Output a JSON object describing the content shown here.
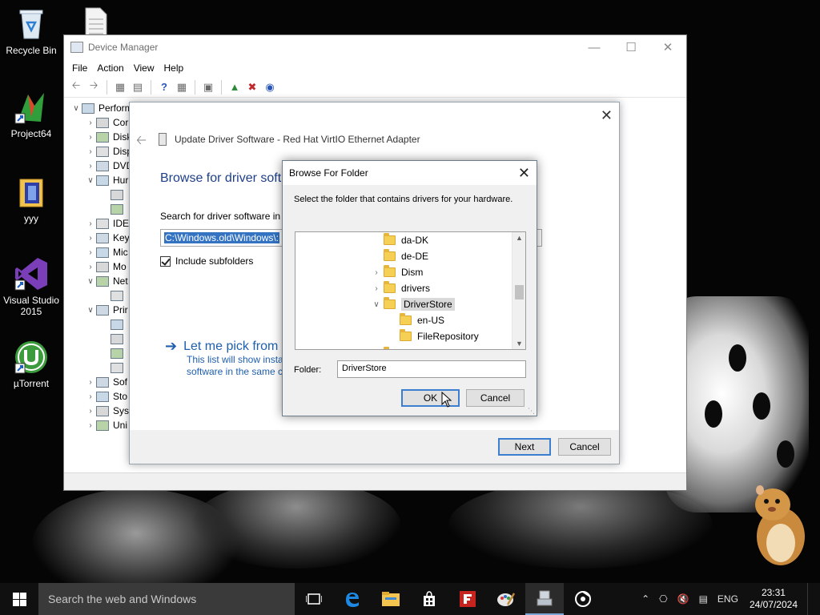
{
  "desktop": {
    "icons": [
      {
        "label": "Recycle Bin"
      },
      {
        "label": "Project64"
      },
      {
        "label": "yyy"
      },
      {
        "label": "Visual Studio 2015"
      },
      {
        "label": "µTorrent"
      }
    ]
  },
  "device_manager": {
    "title": "Device Manager",
    "menu": [
      "File",
      "Action",
      "View",
      "Help"
    ],
    "tree": [
      {
        "label": "Perform",
        "level": 0,
        "expander": "open"
      },
      {
        "label": "Cor",
        "level": 1,
        "expander": "closed"
      },
      {
        "label": "Disk",
        "level": 1,
        "expander": "closed"
      },
      {
        "label": "Disp",
        "level": 1,
        "expander": "closed"
      },
      {
        "label": "DVD",
        "level": 1,
        "expander": "closed"
      },
      {
        "label": "Hur",
        "level": 1,
        "expander": "open"
      },
      {
        "label": "",
        "level": 2,
        "expander": "none"
      },
      {
        "label": "",
        "level": 2,
        "expander": "none"
      },
      {
        "label": "IDE",
        "level": 1,
        "expander": "closed"
      },
      {
        "label": "Key",
        "level": 1,
        "expander": "closed"
      },
      {
        "label": "Mic",
        "level": 1,
        "expander": "closed"
      },
      {
        "label": "Mo",
        "level": 1,
        "expander": "closed"
      },
      {
        "label": "Net",
        "level": 1,
        "expander": "open"
      },
      {
        "label": "",
        "level": 2,
        "expander": "none"
      },
      {
        "label": "Prir",
        "level": 1,
        "expander": "open"
      },
      {
        "label": "",
        "level": 2,
        "expander": "none"
      },
      {
        "label": "",
        "level": 2,
        "expander": "none"
      },
      {
        "label": "",
        "level": 2,
        "expander": "none"
      },
      {
        "label": "",
        "level": 2,
        "expander": "none"
      },
      {
        "label": "Sof",
        "level": 1,
        "expander": "closed"
      },
      {
        "label": "Sto",
        "level": 1,
        "expander": "closed"
      },
      {
        "label": "Sys",
        "level": 1,
        "expander": "closed"
      },
      {
        "label": "Uni",
        "level": 1,
        "expander": "closed"
      }
    ]
  },
  "wizard": {
    "header": "Update Driver Software - Red Hat VirtIO Ethernet Adapter",
    "heading": "Browse for driver soft",
    "search_label": "Search for driver software in t",
    "path_value": "C:\\Windows.old\\Windows\\:",
    "include_subfolders": "Include subfolders",
    "link": "Let me pick from",
    "desc_line1": "This list will show insta",
    "desc_line2": "software in the same c",
    "next": "Next",
    "cancel": "Cancel"
  },
  "browse": {
    "title": "Browse For Folder",
    "description": "Select the folder that contains drivers for your hardware.",
    "tree": [
      {
        "label": "da-DK",
        "level": 0,
        "expander": "none",
        "selected": false
      },
      {
        "label": "de-DE",
        "level": 0,
        "expander": "none",
        "selected": false
      },
      {
        "label": "Dism",
        "level": 0,
        "expander": "closed",
        "selected": false
      },
      {
        "label": "drivers",
        "level": 0,
        "expander": "closed",
        "selected": false
      },
      {
        "label": "DriverStore",
        "level": 0,
        "expander": "open",
        "selected": true
      },
      {
        "label": "en-US",
        "level": 1,
        "expander": "none",
        "selected": false
      },
      {
        "label": "FileRepository",
        "level": 1,
        "expander": "none",
        "selected": false
      }
    ],
    "folder_label": "Folder:",
    "folder_value": "DriverStore",
    "ok": "OK",
    "cancel": "Cancel"
  },
  "taskbar": {
    "search_placeholder": "Search the web and Windows",
    "language": "ENG",
    "time": "23:31",
    "date": "24/07/2024"
  }
}
